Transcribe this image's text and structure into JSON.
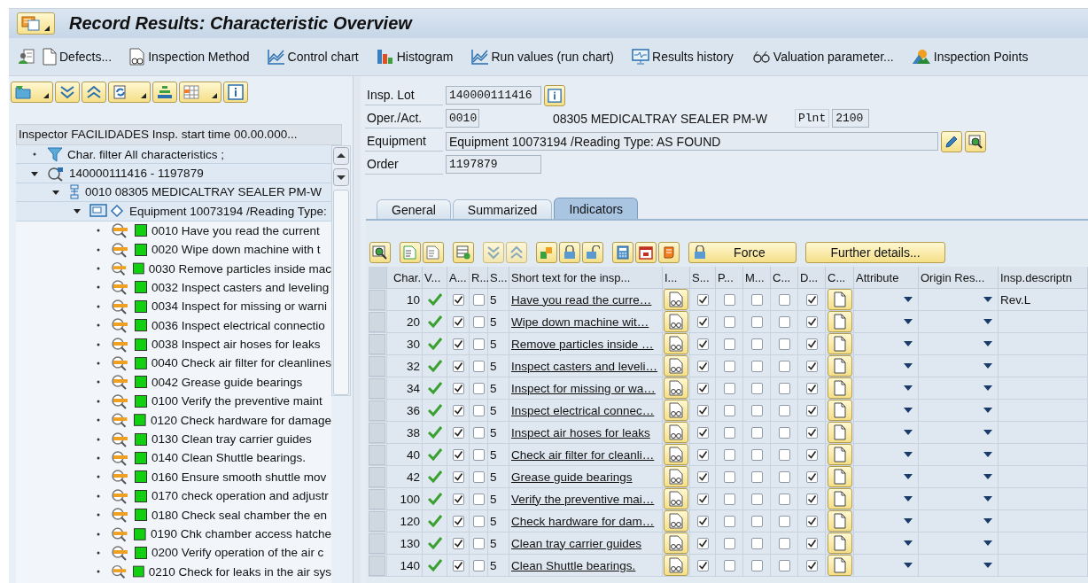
{
  "title_bar": {
    "title": "Record Results: Characteristic Overview"
  },
  "toolbar": [
    {
      "label": "Defects...",
      "kind": "page"
    },
    {
      "label": "Inspection Method",
      "kind": "method"
    },
    {
      "label": "Control chart",
      "kind": "chart"
    },
    {
      "label": "Histogram",
      "kind": "histogram"
    },
    {
      "label": "Run values (run chart)",
      "kind": "chart"
    },
    {
      "label": "Results history",
      "kind": "monitor"
    },
    {
      "label": "Valuation parameter...",
      "kind": "glasses"
    },
    {
      "label": "Inspection Points",
      "kind": "mountain"
    }
  ],
  "tree_header": "Inspector FACILIDADES Insp. start time 00.00.000...",
  "tree": [
    {
      "label": "Char. filter All characteristics ;",
      "kind": "filter"
    },
    {
      "label": "140000111416 - 1197879",
      "kind": "lot",
      "expanded": true,
      "children": [
        {
          "label": "0010 08305 MEDICALTRAY SEALER PM-W",
          "kind": "operation",
          "expanded": true,
          "children": [
            {
              "label": "Equipment 10073194 /Reading Type:",
              "kind": "equipment",
              "expanded": true,
              "children": [
                {
                  "label": "0010 Have you read the current",
                  "kind": "characteristic"
                },
                {
                  "label": "0020 Wipe down machine with t",
                  "kind": "characteristic"
                },
                {
                  "label": "0030 Remove particles inside mac",
                  "kind": "characteristic"
                },
                {
                  "label": "0032 Inspect casters and leveling",
                  "kind": "characteristic"
                },
                {
                  "label": "0034 Inspect for missing or warni",
                  "kind": "characteristic"
                },
                {
                  "label": "0036 Inspect electrical connectio",
                  "kind": "characteristic"
                },
                {
                  "label": "0038 Inspect air hoses for leaks",
                  "kind": "characteristic"
                },
                {
                  "label": "0040 Check air filter for cleanlines",
                  "kind": "characteristic"
                },
                {
                  "label": "0042 Grease guide bearings",
                  "kind": "characteristic"
                },
                {
                  "label": "0100 Verify the preventive maint",
                  "kind": "characteristic"
                },
                {
                  "label": "0120 Check hardware for damage",
                  "kind": "characteristic"
                },
                {
                  "label": "0130 Clean tray carrier guides",
                  "kind": "characteristic"
                },
                {
                  "label": "0140 Clean Shuttle bearings.",
                  "kind": "characteristic"
                },
                {
                  "label": "0160 Ensure smooth shuttle mov",
                  "kind": "characteristic"
                },
                {
                  "label": "0170 check operation and adjustr",
                  "kind": "characteristic"
                },
                {
                  "label": "0180 Check seal chamber the en",
                  "kind": "characteristic"
                },
                {
                  "label": "0190 Chk chamber access hatche",
                  "kind": "characteristic"
                },
                {
                  "label": "0200 Verify operation of the air c",
                  "kind": "characteristic"
                },
                {
                  "label": "0210 Check for leaks in the air sys",
                  "kind": "characteristic"
                }
              ]
            }
          ]
        }
      ]
    }
  ],
  "header": {
    "insp_lot_label": "Insp. Lot",
    "insp_lot": "140000111416",
    "oper_label": "Oper./Act.",
    "oper": "0010",
    "oper_text": "08305 MEDICALTRAY SEALER PM-W",
    "plant_label": "Plnt",
    "plant": "2100",
    "equipment_label": "Equipment",
    "equipment": "Equipment 10073194 /Reading Type: AS FOUND",
    "order_label": "Order",
    "order": "1197879"
  },
  "tabs": [
    {
      "label": "General",
      "selected": false
    },
    {
      "label": "Summarized",
      "selected": false
    },
    {
      "label": "Indicators",
      "selected": true
    }
  ],
  "table_buttons": [
    "Force",
    "Further details..."
  ],
  "table": {
    "columns": [
      "Char.",
      "V...",
      "A...",
      "R...",
      "S...",
      "Short text for the insp...",
      "I...",
      "S...",
      "P...",
      "M...",
      "C...",
      "D...",
      "C...",
      "Attribute",
      "Origin Res...",
      "Insp.descriptn"
    ],
    "rows": [
      {
        "char": "10",
        "valuated": true,
        "a": true,
        "r": false,
        "s": "5",
        "text": "Have you read the curre…",
        "s_flag": true,
        "p": false,
        "m": false,
        "c": false,
        "d": true,
        "insp_description": "Rev.L"
      },
      {
        "char": "20",
        "valuated": true,
        "a": true,
        "r": false,
        "s": "5",
        "text": "Wipe down machine wit…",
        "s_flag": true,
        "p": false,
        "m": false,
        "c": false,
        "d": true
      },
      {
        "char": "30",
        "valuated": true,
        "a": true,
        "r": false,
        "s": "5",
        "text": "Remove particles inside …",
        "s_flag": true,
        "p": false,
        "m": false,
        "c": false,
        "d": true
      },
      {
        "char": "32",
        "valuated": true,
        "a": true,
        "r": false,
        "s": "5",
        "text": "Inspect casters and leveli…",
        "s_flag": true,
        "p": false,
        "m": false,
        "c": false,
        "d": true
      },
      {
        "char": "34",
        "valuated": true,
        "a": true,
        "r": false,
        "s": "5",
        "text": "Inspect for missing or wa…",
        "s_flag": true,
        "p": false,
        "m": false,
        "c": false,
        "d": true
      },
      {
        "char": "36",
        "valuated": true,
        "a": true,
        "r": false,
        "s": "5",
        "text": "Inspect electrical connec…",
        "s_flag": true,
        "p": false,
        "m": false,
        "c": false,
        "d": true
      },
      {
        "char": "38",
        "valuated": true,
        "a": true,
        "r": false,
        "s": "5",
        "text": "Inspect air hoses for leaks",
        "s_flag": true,
        "p": false,
        "m": false,
        "c": false,
        "d": true
      },
      {
        "char": "40",
        "valuated": true,
        "a": true,
        "r": false,
        "s": "5",
        "text": "Check air filter for cleanli…",
        "s_flag": true,
        "p": false,
        "m": false,
        "c": false,
        "d": true
      },
      {
        "char": "42",
        "valuated": true,
        "a": true,
        "r": false,
        "s": "5",
        "text": "Grease guide bearings",
        "s_flag": true,
        "p": false,
        "m": false,
        "c": false,
        "d": true
      },
      {
        "char": "100",
        "valuated": true,
        "a": true,
        "r": false,
        "s": "5",
        "text": "Verify the preventive mai…",
        "s_flag": true,
        "p": false,
        "m": false,
        "c": false,
        "d": true
      },
      {
        "char": "120",
        "valuated": true,
        "a": true,
        "r": false,
        "s": "5",
        "text": "Check hardware for dam…",
        "s_flag": true,
        "p": false,
        "m": false,
        "c": false,
        "d": true
      },
      {
        "char": "130",
        "valuated": true,
        "a": true,
        "r": false,
        "s": "5",
        "text": "Clean tray carrier guides",
        "s_flag": true,
        "p": false,
        "m": false,
        "c": false,
        "d": true
      },
      {
        "char": "140",
        "valuated": true,
        "a": true,
        "r": false,
        "s": "5",
        "text": "Clean Shuttle bearings.",
        "s_flag": true,
        "p": false,
        "m": false,
        "c": false,
        "d": true
      }
    ]
  }
}
